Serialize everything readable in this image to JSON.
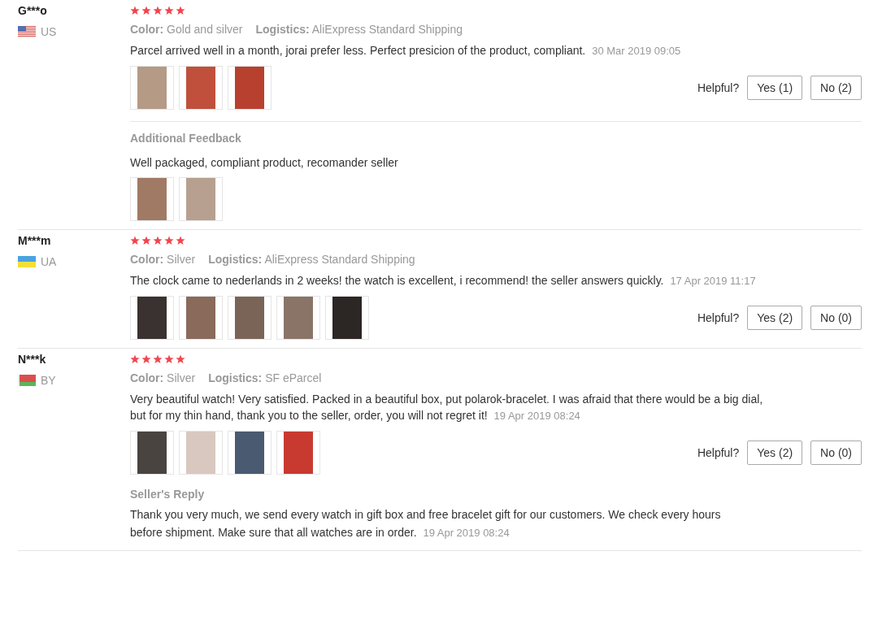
{
  "reviews": [
    {
      "name": "G***o",
      "flag": {
        "kind": "us"
      },
      "country": "US",
      "stars": 5,
      "color_label": "Color:",
      "color_value": "Gold and silver",
      "logistics_label": "Logistics:",
      "logistics_value": "AliExpress Standard Shipping",
      "text": "Parcel arrived well in a month, jorai prefer less. Perfect presicion of the product, compliant.",
      "date": "30 Mar 2019 09:05",
      "photos": [
        {
          "color": "#b59a86"
        },
        {
          "color": "#c0503c"
        },
        {
          "color": "#b8402e"
        }
      ],
      "helpful": {
        "label": "Helpful?",
        "yes": "Yes (1)",
        "no": "No (2)"
      },
      "additional": {
        "title": "Additional Feedback",
        "text": "Well packaged, compliant product, recomander seller",
        "photos": [
          {
            "color": "#a07a64"
          },
          {
            "color": "#b8a090"
          }
        ]
      }
    },
    {
      "name": "M***m",
      "flag": {
        "kind": "ua"
      },
      "country": "UA",
      "stars": 5,
      "color_label": "Color:",
      "color_value": "Silver",
      "logistics_label": "Logistics:",
      "logistics_value": "AliExpress Standard Shipping",
      "text": "The clock came to nederlands in 2 weeks! the watch is excellent, i recommend! the seller answers quickly.",
      "date": "17 Apr 2019 11:17",
      "photos": [
        {
          "color": "#3a3230"
        },
        {
          "color": "#8a6a5a"
        },
        {
          "color": "#7a6458"
        },
        {
          "color": "#8a7468"
        },
        {
          "color": "#2c2624"
        }
      ],
      "helpful": {
        "label": "Helpful?",
        "yes": "Yes (2)",
        "no": "No (0)"
      }
    },
    {
      "name": "N***k",
      "flag": {
        "kind": "by"
      },
      "country": "BY",
      "stars": 5,
      "color_label": "Color:",
      "color_value": "Silver",
      "logistics_label": "Logistics:",
      "logistics_value": "SF eParcel",
      "text": "Very beautiful watch! Very satisfied. Packed in a beautiful box, put polarok-bracelet. I was afraid that there would be a big dial, but for my thin hand, thank you to the seller, order, you will not regret it!",
      "date": "19 Apr 2019 08:24",
      "photos": [
        {
          "color": "#4a4440"
        },
        {
          "color": "#d8c8c0"
        },
        {
          "color": "#4a5a70"
        },
        {
          "color": "#c83a30"
        }
      ],
      "helpful": {
        "label": "Helpful?",
        "yes": "Yes (2)",
        "no": "No (0)"
      },
      "reply": {
        "title": "Seller's Reply",
        "text": "Thank you very much, we send every watch in gift box and free bracelet gift for our customers. We check every hours before shipment. Make sure that all watches are in order.",
        "date": "19 Apr 2019 08:24"
      }
    }
  ]
}
